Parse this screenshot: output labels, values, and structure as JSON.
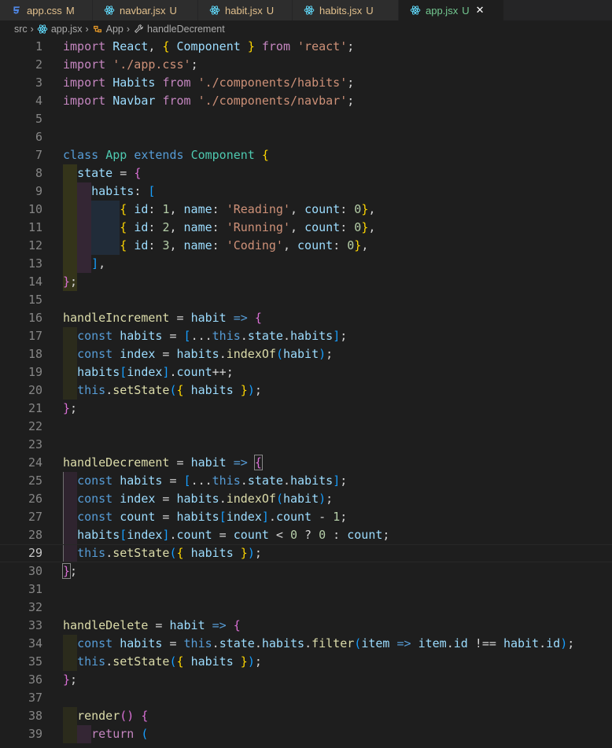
{
  "tabs": [
    {
      "name": "app.css",
      "status": "M",
      "icon": "css-icon",
      "active": false
    },
    {
      "name": "navbar.jsx",
      "status": "U",
      "icon": "react-icon",
      "active": false
    },
    {
      "name": "habit.jsx",
      "status": "U",
      "icon": "react-icon",
      "active": false
    },
    {
      "name": "habits.jsx",
      "status": "U",
      "icon": "react-icon",
      "active": false
    },
    {
      "name": "app.jsx",
      "status": "U",
      "icon": "react-icon",
      "active": true
    }
  ],
  "breadcrumb": [
    "src",
    "app.jsx",
    "App",
    "handleDecrement"
  ],
  "colors": {
    "editor_bg": "#1e1e1e",
    "tab_bar_bg": "#252526",
    "modified": "#e2c08d",
    "untracked": "#73c991"
  },
  "current_line": 29,
  "lines": [
    [
      [
        "kw2",
        "import"
      ],
      [
        "op",
        " "
      ],
      [
        "var",
        "React"
      ],
      [
        "op",
        ", "
      ],
      [
        "p1",
        "{"
      ],
      [
        "op",
        " "
      ],
      [
        "var",
        "Component"
      ],
      [
        "op",
        " "
      ],
      [
        "p1",
        "}"
      ],
      [
        "op",
        " "
      ],
      [
        "kw2",
        "from"
      ],
      [
        "op",
        " "
      ],
      [
        "str",
        "'react'"
      ],
      [
        "op",
        ";"
      ]
    ],
    [
      [
        "kw2",
        "import"
      ],
      [
        "op",
        " "
      ],
      [
        "str",
        "'./app.css'"
      ],
      [
        "op",
        ";"
      ]
    ],
    [
      [
        "kw2",
        "import"
      ],
      [
        "op",
        " "
      ],
      [
        "var",
        "Habits"
      ],
      [
        "op",
        " "
      ],
      [
        "kw2",
        "from"
      ],
      [
        "op",
        " "
      ],
      [
        "str",
        "'./components/habits'"
      ],
      [
        "op",
        ";"
      ]
    ],
    [
      [
        "kw2",
        "import"
      ],
      [
        "op",
        " "
      ],
      [
        "var",
        "Navbar"
      ],
      [
        "op",
        " "
      ],
      [
        "kw2",
        "from"
      ],
      [
        "op",
        " "
      ],
      [
        "str",
        "'./components/navbar'"
      ],
      [
        "op",
        ";"
      ]
    ],
    [],
    [],
    [
      [
        "kw",
        "class"
      ],
      [
        "op",
        " "
      ],
      [
        "cls",
        "App"
      ],
      [
        "op",
        " "
      ],
      [
        "kw",
        "extends"
      ],
      [
        "op",
        " "
      ],
      [
        "cls",
        "Component"
      ],
      [
        "op",
        " "
      ],
      [
        "p1",
        "{"
      ]
    ],
    [
      [
        "op",
        "  "
      ],
      [
        "var",
        "state"
      ],
      [
        "op",
        " = "
      ],
      [
        "p2",
        "{"
      ]
    ],
    [
      [
        "op",
        "    "
      ],
      [
        "var",
        "habits"
      ],
      [
        "op",
        ": "
      ],
      [
        "p3",
        "["
      ]
    ],
    [
      [
        "op",
        "        "
      ],
      [
        "p1",
        "{"
      ],
      [
        "op",
        " "
      ],
      [
        "var",
        "id"
      ],
      [
        "op",
        ": "
      ],
      [
        "num",
        "1"
      ],
      [
        "op",
        ", "
      ],
      [
        "var",
        "name"
      ],
      [
        "op",
        ": "
      ],
      [
        "str",
        "'Reading'"
      ],
      [
        "op",
        ", "
      ],
      [
        "var",
        "count"
      ],
      [
        "op",
        ": "
      ],
      [
        "num",
        "0"
      ],
      [
        "p1",
        "}"
      ],
      [
        "op",
        ","
      ]
    ],
    [
      [
        "op",
        "        "
      ],
      [
        "p1",
        "{"
      ],
      [
        "op",
        " "
      ],
      [
        "var",
        "id"
      ],
      [
        "op",
        ": "
      ],
      [
        "num",
        "2"
      ],
      [
        "op",
        ", "
      ],
      [
        "var",
        "name"
      ],
      [
        "op",
        ": "
      ],
      [
        "str",
        "'Running'"
      ],
      [
        "op",
        ", "
      ],
      [
        "var",
        "count"
      ],
      [
        "op",
        ": "
      ],
      [
        "num",
        "0"
      ],
      [
        "p1",
        "}"
      ],
      [
        "op",
        ","
      ]
    ],
    [
      [
        "op",
        "        "
      ],
      [
        "p1",
        "{"
      ],
      [
        "op",
        " "
      ],
      [
        "var",
        "id"
      ],
      [
        "op",
        ": "
      ],
      [
        "num",
        "3"
      ],
      [
        "op",
        ", "
      ],
      [
        "var",
        "name"
      ],
      [
        "op",
        ": "
      ],
      [
        "str",
        "'Coding'"
      ],
      [
        "op",
        ", "
      ],
      [
        "var",
        "count"
      ],
      [
        "op",
        ": "
      ],
      [
        "num",
        "0"
      ],
      [
        "p1",
        "}"
      ],
      [
        "op",
        ","
      ]
    ],
    [
      [
        "op",
        "    "
      ],
      [
        "p3",
        "]"
      ],
      [
        "op",
        ","
      ]
    ],
    [
      [
        "p2",
        "}"
      ],
      [
        "op",
        ";"
      ]
    ],
    [],
    [
      [
        "fn",
        "handleIncrement"
      ],
      [
        "op",
        " = "
      ],
      [
        "var",
        "habit"
      ],
      [
        "op",
        " "
      ],
      [
        "kw",
        "=>"
      ],
      [
        "op",
        " "
      ],
      [
        "p2",
        "{"
      ]
    ],
    [
      [
        "op",
        "  "
      ],
      [
        "kw",
        "const"
      ],
      [
        "op",
        " "
      ],
      [
        "var",
        "habits"
      ],
      [
        "op",
        " = "
      ],
      [
        "p3",
        "["
      ],
      [
        "op",
        "..."
      ],
      [
        "kw",
        "this"
      ],
      [
        "op",
        "."
      ],
      [
        "var",
        "state"
      ],
      [
        "op",
        "."
      ],
      [
        "var",
        "habits"
      ],
      [
        "p3",
        "]"
      ],
      [
        "op",
        ";"
      ]
    ],
    [
      [
        "op",
        "  "
      ],
      [
        "kw",
        "const"
      ],
      [
        "op",
        " "
      ],
      [
        "var",
        "index"
      ],
      [
        "op",
        " = "
      ],
      [
        "var",
        "habits"
      ],
      [
        "op",
        "."
      ],
      [
        "fn",
        "indexOf"
      ],
      [
        "p3",
        "("
      ],
      [
        "var",
        "habit"
      ],
      [
        "p3",
        ")"
      ],
      [
        "op",
        ";"
      ]
    ],
    [
      [
        "op",
        "  "
      ],
      [
        "var",
        "habits"
      ],
      [
        "p3",
        "["
      ],
      [
        "var",
        "index"
      ],
      [
        "p3",
        "]"
      ],
      [
        "op",
        "."
      ],
      [
        "var",
        "count"
      ],
      [
        "op",
        "++;"
      ]
    ],
    [
      [
        "op",
        "  "
      ],
      [
        "kw",
        "this"
      ],
      [
        "op",
        "."
      ],
      [
        "fn",
        "setState"
      ],
      [
        "p3",
        "("
      ],
      [
        "p1",
        "{"
      ],
      [
        "op",
        " "
      ],
      [
        "var",
        "habits"
      ],
      [
        "op",
        " "
      ],
      [
        "p1",
        "}"
      ],
      [
        "p3",
        ")"
      ],
      [
        "op",
        ";"
      ]
    ],
    [
      [
        "p2",
        "}"
      ],
      [
        "op",
        ";"
      ]
    ],
    [],
    [],
    [
      [
        "fn",
        "handleDecrement"
      ],
      [
        "op",
        " = "
      ],
      [
        "var",
        "habit"
      ],
      [
        "op",
        " "
      ],
      [
        "kw",
        "=>"
      ],
      [
        "op",
        " "
      ],
      [
        "p2bm",
        "{"
      ]
    ],
    [
      [
        "op",
        "  "
      ],
      [
        "kw",
        "const"
      ],
      [
        "op",
        " "
      ],
      [
        "var",
        "habits"
      ],
      [
        "op",
        " = "
      ],
      [
        "p3",
        "["
      ],
      [
        "op",
        "..."
      ],
      [
        "kw",
        "this"
      ],
      [
        "op",
        "."
      ],
      [
        "var",
        "state"
      ],
      [
        "op",
        "."
      ],
      [
        "var",
        "habits"
      ],
      [
        "p3",
        "]"
      ],
      [
        "op",
        ";"
      ]
    ],
    [
      [
        "op",
        "  "
      ],
      [
        "kw",
        "const"
      ],
      [
        "op",
        " "
      ],
      [
        "var",
        "index"
      ],
      [
        "op",
        " = "
      ],
      [
        "var",
        "habits"
      ],
      [
        "op",
        "."
      ],
      [
        "fn",
        "indexOf"
      ],
      [
        "p3",
        "("
      ],
      [
        "var",
        "habit"
      ],
      [
        "p3",
        ")"
      ],
      [
        "op",
        ";"
      ]
    ],
    [
      [
        "op",
        "  "
      ],
      [
        "kw",
        "const"
      ],
      [
        "op",
        " "
      ],
      [
        "var",
        "count"
      ],
      [
        "op",
        " = "
      ],
      [
        "var",
        "habits"
      ],
      [
        "p3",
        "["
      ],
      [
        "var",
        "index"
      ],
      [
        "p3",
        "]"
      ],
      [
        "op",
        "."
      ],
      [
        "var",
        "count"
      ],
      [
        "op",
        " - "
      ],
      [
        "num",
        "1"
      ],
      [
        "op",
        ";"
      ]
    ],
    [
      [
        "op",
        "  "
      ],
      [
        "var",
        "habits"
      ],
      [
        "p3",
        "["
      ],
      [
        "var",
        "index"
      ],
      [
        "p3",
        "]"
      ],
      [
        "op",
        "."
      ],
      [
        "var",
        "count"
      ],
      [
        "op",
        " = "
      ],
      [
        "var",
        "count"
      ],
      [
        "op",
        " < "
      ],
      [
        "num",
        "0"
      ],
      [
        "op",
        " ? "
      ],
      [
        "num",
        "0"
      ],
      [
        "op",
        " : "
      ],
      [
        "var",
        "count"
      ],
      [
        "op",
        ";"
      ]
    ],
    [
      [
        "op",
        "  "
      ],
      [
        "kw",
        "this"
      ],
      [
        "op",
        "."
      ],
      [
        "fn",
        "setState"
      ],
      [
        "p3",
        "("
      ],
      [
        "p1",
        "{"
      ],
      [
        "op",
        " "
      ],
      [
        "var",
        "habits"
      ],
      [
        "op",
        " "
      ],
      [
        "p1",
        "}"
      ],
      [
        "p3",
        ")"
      ],
      [
        "op",
        ";"
      ]
    ],
    [
      [
        "p2bm",
        "}"
      ],
      [
        "op",
        ";"
      ]
    ],
    [],
    [],
    [
      [
        "fn",
        "handleDelete"
      ],
      [
        "op",
        " = "
      ],
      [
        "var",
        "habit"
      ],
      [
        "op",
        " "
      ],
      [
        "kw",
        "=>"
      ],
      [
        "op",
        " "
      ],
      [
        "p2",
        "{"
      ]
    ],
    [
      [
        "op",
        "  "
      ],
      [
        "kw",
        "const"
      ],
      [
        "op",
        " "
      ],
      [
        "var",
        "habits"
      ],
      [
        "op",
        " = "
      ],
      [
        "kw",
        "this"
      ],
      [
        "op",
        "."
      ],
      [
        "var",
        "state"
      ],
      [
        "op",
        "."
      ],
      [
        "var",
        "habits"
      ],
      [
        "op",
        "."
      ],
      [
        "fn",
        "filter"
      ],
      [
        "p3",
        "("
      ],
      [
        "var",
        "item"
      ],
      [
        "op",
        " "
      ],
      [
        "kw",
        "=>"
      ],
      [
        "op",
        " "
      ],
      [
        "var",
        "item"
      ],
      [
        "op",
        "."
      ],
      [
        "var",
        "id"
      ],
      [
        "op",
        " !== "
      ],
      [
        "var",
        "habit"
      ],
      [
        "op",
        "."
      ],
      [
        "var",
        "id"
      ],
      [
        "p3",
        ")"
      ],
      [
        "op",
        ";"
      ]
    ],
    [
      [
        "op",
        "  "
      ],
      [
        "kw",
        "this"
      ],
      [
        "op",
        "."
      ],
      [
        "fn",
        "setState"
      ],
      [
        "p3",
        "("
      ],
      [
        "p1",
        "{"
      ],
      [
        "op",
        " "
      ],
      [
        "var",
        "habits"
      ],
      [
        "op",
        " "
      ],
      [
        "p1",
        "}"
      ],
      [
        "p3",
        ")"
      ],
      [
        "op",
        ";"
      ]
    ],
    [
      [
        "p2",
        "}"
      ],
      [
        "op",
        ";"
      ]
    ],
    [],
    [
      [
        "op",
        "  "
      ],
      [
        "fn",
        "render"
      ],
      [
        "p2",
        "()"
      ],
      [
        "op",
        " "
      ],
      [
        "p2",
        "{"
      ]
    ],
    [
      [
        "op",
        "    "
      ],
      [
        "kw2",
        "return"
      ],
      [
        "op",
        " "
      ],
      [
        "p3",
        "("
      ]
    ]
  ]
}
